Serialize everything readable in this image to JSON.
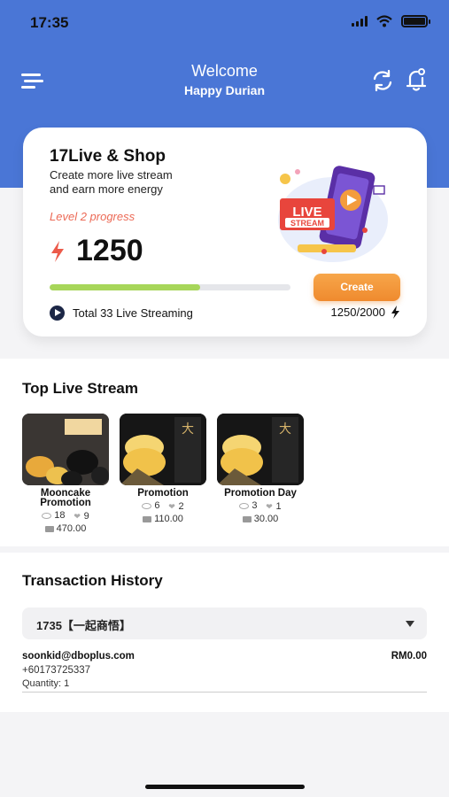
{
  "status_bar": {
    "time": "17:35"
  },
  "header": {
    "title": "Welcome",
    "user_name": "Happy Durian"
  },
  "card": {
    "title": "17Live & Shop",
    "subtitle_line1": "Create more live stream",
    "subtitle_line2": "and earn more energy",
    "level_text": "Level 2 progress",
    "energy": "1250",
    "progress_fraction": 0.625,
    "create_label": "Create",
    "total_text": "Total 33 Live Streaming",
    "progress_text": "1250/2000",
    "illustration_label_1": "LIVE",
    "illustration_label_2": "STREAM"
  },
  "top_live": {
    "title": "Top Live Stream",
    "items": [
      {
        "name": "Mooncake Promotion",
        "views": "18",
        "likes": "9",
        "amount": "470.00"
      },
      {
        "name": "Promotion",
        "views": "6",
        "likes": "2",
        "amount": "110.00"
      },
      {
        "name": "Promotion Day",
        "views": "3",
        "likes": "1",
        "amount": "30.00"
      }
    ]
  },
  "transactions": {
    "title": "Transaction History",
    "selected": "1735【一起商悟】",
    "rows": [
      {
        "email": "soonkid@dboplus.com",
        "amount": "RM0.00",
        "phone": "+60173725337",
        "quantity": "Quantity: 1"
      }
    ]
  },
  "colors": {
    "header_blue": "#4a76d6",
    "accent_orange": "#ef8a2e",
    "progress_green": "#a7d65a",
    "level_red": "#ec6a56"
  }
}
